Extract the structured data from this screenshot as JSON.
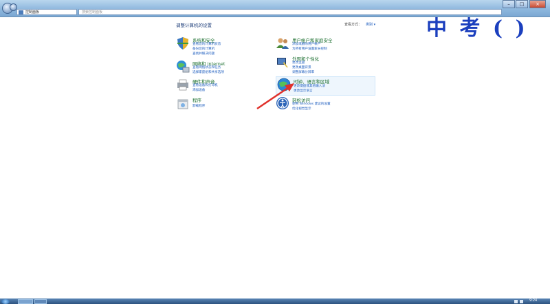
{
  "window": {
    "address": "控制面板",
    "search_placeholder": "搜索控制面板"
  },
  "watermark": "中 考 ( )",
  "page_title": "调整计算机的设置",
  "view_by": {
    "label": "查看方式：",
    "value": "类别 ▾"
  },
  "categories": [
    {
      "title": "系统和安全",
      "links": [
        "查看您的计算机状态",
        "备份您的计算机",
        "查找并解决问题"
      ]
    },
    {
      "title": "网络和 Internet",
      "links": [
        "查看网络状态和任务",
        "选择家庭组和共享选项"
      ]
    },
    {
      "title": "硬件和声音",
      "links": [
        "查看设备和打印机",
        "添加设备"
      ]
    },
    {
      "title": "程序",
      "links": [
        "卸载程序"
      ]
    },
    {
      "title": "用户帐户和家庭安全",
      "links": [
        "添加或删除用户帐户",
        "为所有用户设置家长控制"
      ]
    },
    {
      "title": "外观和个性化",
      "links": [
        "更改主题",
        "更改桌面背景",
        "调整屏幕分辨率"
      ]
    },
    {
      "title": "时钟、语言和区域",
      "links": [
        "更改键盘或其他输入法",
        "更改显示语言"
      ]
    },
    {
      "title": "轻松访问",
      "links": [
        "使用 Windows 建议的设置",
        "优化视觉显示"
      ]
    }
  ],
  "taskbar": {
    "clock": "9:24"
  },
  "colors": {
    "link": "#1d5dbf",
    "category_title": "#1a6e2e",
    "annotation_arrow": "#e0312b"
  }
}
